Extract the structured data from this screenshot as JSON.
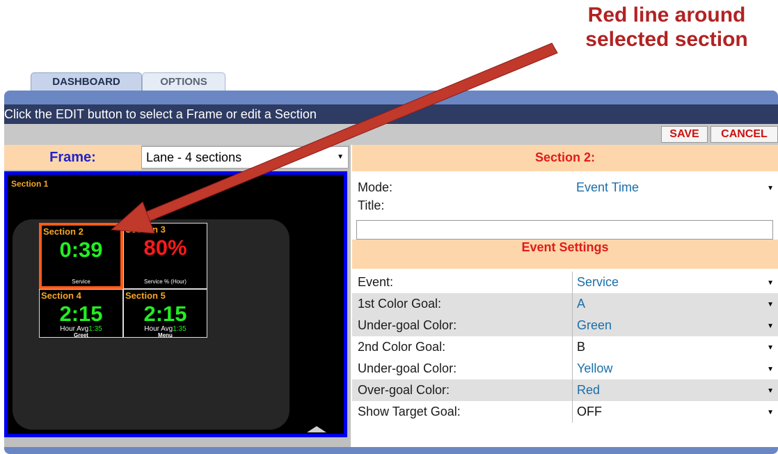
{
  "annotation": {
    "line1": "Red line around",
    "line2": "selected section"
  },
  "tabs": [
    {
      "label": "DASHBOARD"
    },
    {
      "label": "OPTIONS"
    }
  ],
  "instruction": "Click the EDIT button to select a Frame or edit a Section",
  "toolbar": {
    "save": "SAVE",
    "cancel": "CANCEL"
  },
  "frame": {
    "label": "Frame:",
    "value": "Lane - 4 sections"
  },
  "preview": {
    "section1": "Section 1",
    "sections": [
      {
        "name": "Section 2",
        "value": "0:39",
        "caption": "Service",
        "color": "#22ee22"
      },
      {
        "name": "Section 3",
        "value": "80%",
        "caption": "Service % (Hour)",
        "color": "#ff1a1a"
      },
      {
        "name": "Section 4",
        "value": "2:15",
        "avg_label": "Hour Avg",
        "avg_value": "1:35",
        "caption": "Greet",
        "color": "#22ee22"
      },
      {
        "name": "Section 5",
        "value": "2:15",
        "avg_label": "Hour Avg",
        "avg_value": "1:35",
        "caption": "Menu",
        "color": "#22ee22"
      }
    ],
    "selected_border_color": "#ff5a1a"
  },
  "section_header": "Section 2:",
  "mode": {
    "label": "Mode:",
    "value": "Event Time"
  },
  "title_field": {
    "label": "Title:",
    "value": ""
  },
  "event_header": "Event Settings",
  "settings": [
    {
      "label": "Event:",
      "value": "Service"
    },
    {
      "label": "1st Color Goal:",
      "value": "A"
    },
    {
      "label": "Under-goal Color:",
      "value": "Green"
    },
    {
      "label": "2nd Color Goal:",
      "value": "B"
    },
    {
      "label": "Under-goal Color:",
      "value": "Yellow"
    },
    {
      "label": "Over-goal Color:",
      "value": "Red"
    },
    {
      "label": "Show Target Goal:",
      "value": "OFF"
    }
  ]
}
